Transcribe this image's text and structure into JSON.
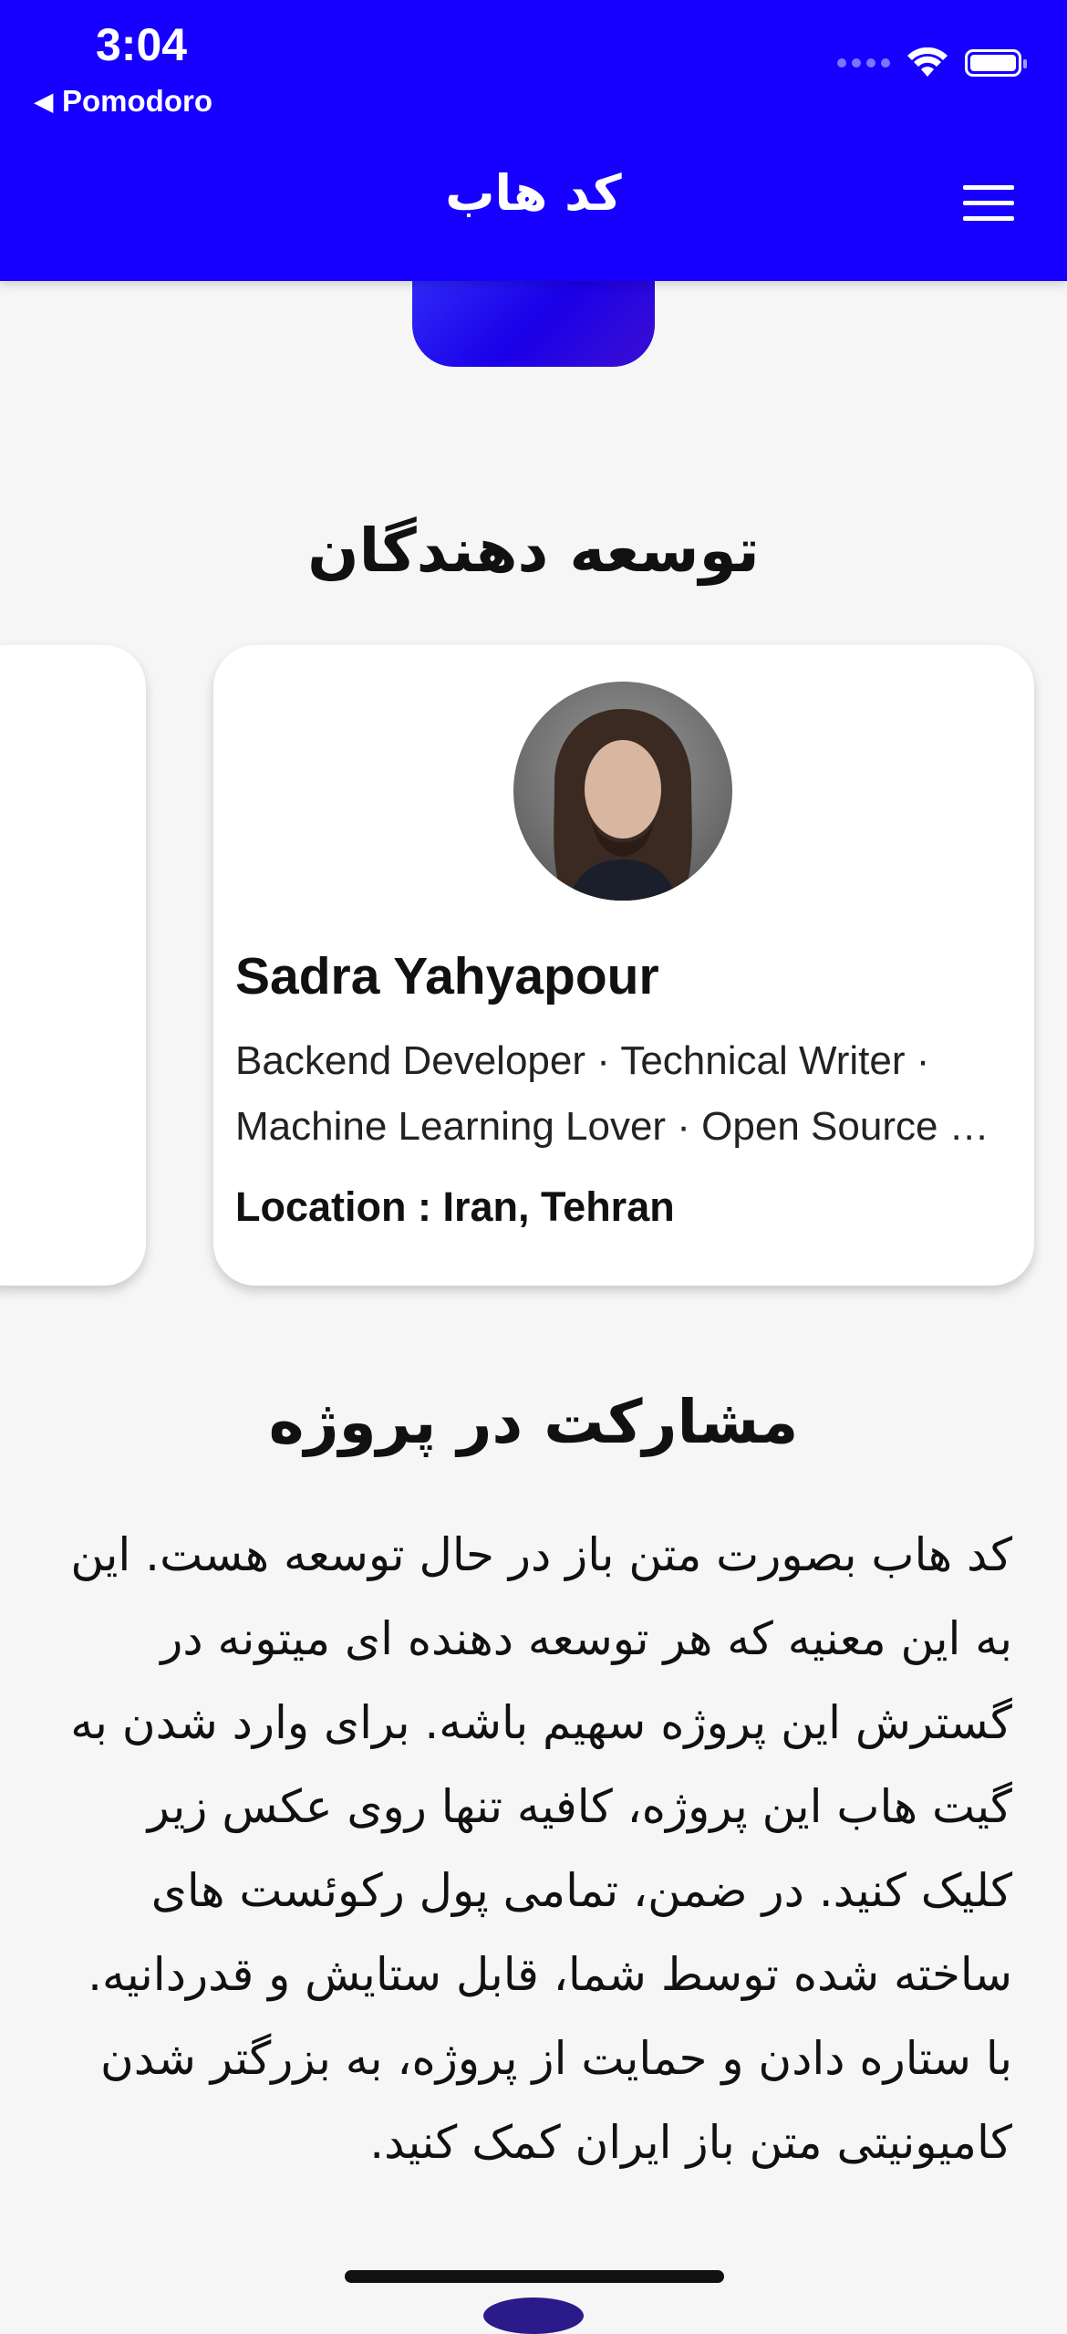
{
  "status_bar": {
    "time": "3:04",
    "back_label": "Pomodoro"
  },
  "header": {
    "title": "کد هاب",
    "menu_icon": "hamburger-menu-icon"
  },
  "developers_section": {
    "title": "توسعه دهندگان",
    "cards": [
      {
        "name": "Sadra Yahyapour",
        "bio": "Backend Developer · Technical Writer · Machine Learning Lover · Open Source …",
        "location": "Location : Iran, Tehran"
      }
    ]
  },
  "contribution_section": {
    "title": "مشارکت در پروژه",
    "text": "کد هاب بصورت متن باز در حال توسعه هست. این به این معنیه که هر توسعه دهنده ای میتونه در گسترش این پروژه سهیم باشه. برای وارد شدن به گیت هاب این پروژه، کافیه تنها روی عکس زیر کلیک کنید. در ضمن، تمامی پول رکوئست های ساخته شده توسط شما، قابل ستایش و قدردانیه. با ستاره دادن و حمایت از پروژه، به بزرگتر شدن کامیونیتی متن باز ایران کمک کنید."
  },
  "colors": {
    "header_bg": "#1700ff",
    "page_bg": "#f6f6f6",
    "card_bg": "#ffffff"
  }
}
